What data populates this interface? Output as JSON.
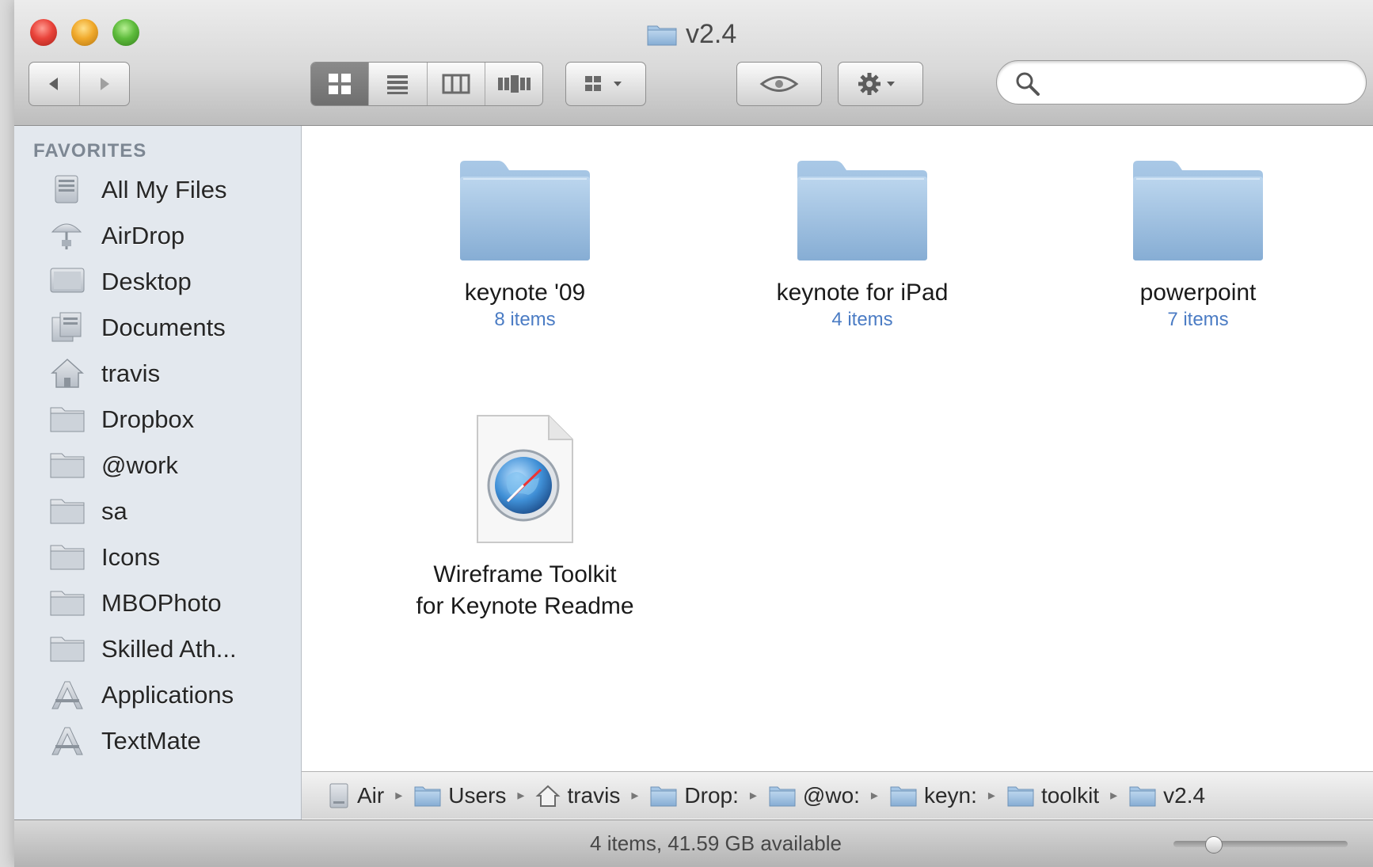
{
  "window": {
    "title": "v2.4"
  },
  "toolbar": {
    "back_icon": "back-arrow-icon",
    "forward_icon": "forward-arrow-icon",
    "view_modes": [
      "icon-view",
      "list-view",
      "column-view",
      "cover-flow-view"
    ],
    "active_view": "icon-view",
    "arrange_icon": "arrange-icon",
    "quicklook_icon": "eye-icon",
    "action_icon": "gear-icon"
  },
  "search": {
    "placeholder": "",
    "value": ""
  },
  "sidebar": {
    "header": "FAVORITES",
    "items": [
      {
        "label": "All My Files",
        "icon": "all-files-icon"
      },
      {
        "label": "AirDrop",
        "icon": "airdrop-icon"
      },
      {
        "label": "Desktop",
        "icon": "desktop-icon"
      },
      {
        "label": "Documents",
        "icon": "documents-icon"
      },
      {
        "label": "travis",
        "icon": "home-icon"
      },
      {
        "label": "Dropbox",
        "icon": "folder-icon"
      },
      {
        "label": "@work",
        "icon": "folder-icon"
      },
      {
        "label": "sa",
        "icon": "folder-icon"
      },
      {
        "label": "Icons",
        "icon": "folder-icon"
      },
      {
        "label": "MBOPhoto",
        "icon": "folder-icon"
      },
      {
        "label": "Skilled Ath...",
        "icon": "folder-icon"
      },
      {
        "label": "Applications",
        "icon": "applications-icon"
      },
      {
        "label": "TextMate",
        "icon": "applications-icon"
      }
    ]
  },
  "content": {
    "items": [
      {
        "name": "keynote '09",
        "count": "8 items",
        "type": "folder"
      },
      {
        "name": "keynote for iPad",
        "count": "4 items",
        "type": "folder"
      },
      {
        "name": "powerpoint",
        "count": "7 items",
        "type": "folder"
      },
      {
        "name_line1": "Wireframe Toolkit",
        "name_line2": "for Keynote Readme",
        "type": "webloc-document"
      }
    ]
  },
  "pathbar": {
    "crumbs": [
      {
        "label": "Air",
        "icon": "hard-drive-icon"
      },
      {
        "label": "Users",
        "icon": "folder-icon"
      },
      {
        "label": "travis",
        "icon": "home-icon"
      },
      {
        "label": "Drop:",
        "icon": "folder-icon"
      },
      {
        "label": "@wo:",
        "icon": "folder-icon"
      },
      {
        "label": "keyn:",
        "icon": "folder-icon"
      },
      {
        "label": "toolkit",
        "icon": "folder-icon"
      },
      {
        "label": "v2.4",
        "icon": "folder-icon"
      }
    ]
  },
  "statusbar": {
    "text": "4 items, 41.59 GB available",
    "icon_size_fraction": 0.2
  },
  "colors": {
    "sidebar_bg": "#e3e8ee",
    "folder_blue": "#9dc0e2",
    "item_count_blue": "#4b7cc4"
  }
}
